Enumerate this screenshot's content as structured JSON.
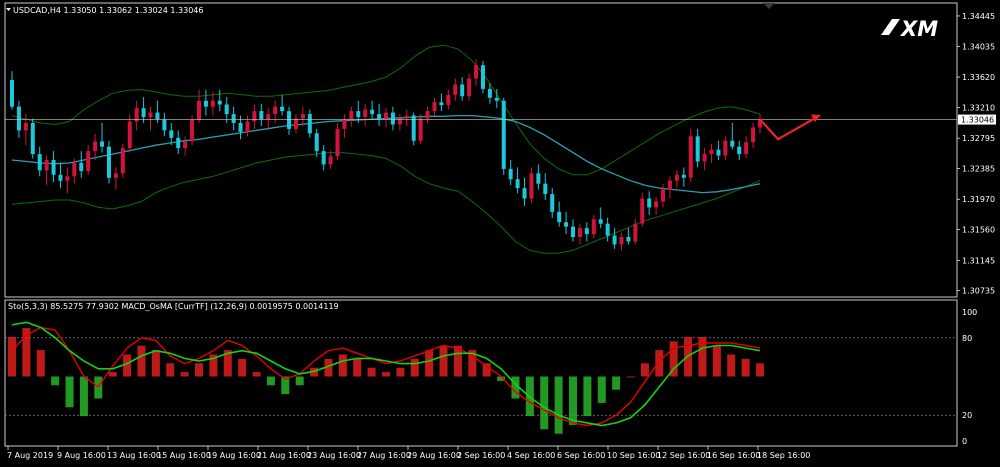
{
  "symbol_header": "USDCAD,H4  1.33050 1.33062 1.33024 1.33046",
  "indicator_header": "Sto(5,3,3) 85.5275 77.9302  MACD_OsMA [CurrTF] (12,26,9) 0.0019575 0.0014119",
  "brand": "XM",
  "current_price": "1.33046",
  "colors": {
    "background": "#000000",
    "bull_candle": "#d2143c",
    "bear_candle": "#1ec8dc",
    "ma": "#28a0b4",
    "bands": "#0a6e0a",
    "stoch_main": "#e60000",
    "stoch_signal": "#14d214",
    "osma_up": "#e11e1e",
    "osma_down": "#28b428",
    "arrow": "#e62828"
  },
  "chart_data": [
    {
      "type": "candlestick",
      "title": "USDCAD,H4",
      "price_ticks": [
        "1.34445",
        "1.34035",
        "1.33620",
        "1.33210",
        "1.32795",
        "1.32385",
        "1.31970",
        "1.31560",
        "1.31145",
        "1.30735"
      ],
      "ylim": [
        1.3065,
        1.3462
      ],
      "current_price": 1.33046,
      "forecast": {
        "type": "zigzag arrow",
        "direction": "down then up"
      },
      "candles": [
        [
          1.3358,
          1.337,
          1.3318,
          1.3322
        ],
        [
          1.3322,
          1.333,
          1.328,
          1.329
        ],
        [
          1.329,
          1.3312,
          1.327,
          1.33
        ],
        [
          1.33,
          1.3306,
          1.3252,
          1.3258
        ],
        [
          1.3258,
          1.3268,
          1.3228,
          1.3236
        ],
        [
          1.3236,
          1.3256,
          1.3216,
          1.325
        ],
        [
          1.325,
          1.3262,
          1.322,
          1.323
        ],
        [
          1.323,
          1.3246,
          1.3212,
          1.3222
        ],
        [
          1.3222,
          1.324,
          1.3205,
          1.3228
        ],
        [
          1.3228,
          1.3252,
          1.3218,
          1.3246
        ],
        [
          1.3246,
          1.3262,
          1.3226,
          1.3235
        ],
        [
          1.3235,
          1.327,
          1.323,
          1.3262
        ],
        [
          1.3262,
          1.3285,
          1.325,
          1.3275
        ],
        [
          1.3275,
          1.33,
          1.326,
          1.3268
        ],
        [
          1.3268,
          1.3276,
          1.3218,
          1.3226
        ],
        [
          1.3226,
          1.324,
          1.321,
          1.3232
        ],
        [
          1.3232,
          1.3272,
          1.3226,
          1.3266
        ],
        [
          1.3266,
          1.3312,
          1.326,
          1.3302
        ],
        [
          1.3302,
          1.333,
          1.329,
          1.332
        ],
        [
          1.332,
          1.3335,
          1.33,
          1.3308
        ],
        [
          1.3308,
          1.3322,
          1.329,
          1.3314
        ],
        [
          1.3314,
          1.333,
          1.33,
          1.3305
        ],
        [
          1.3305,
          1.3314,
          1.3282,
          1.329
        ],
        [
          1.329,
          1.33,
          1.327,
          1.328
        ],
        [
          1.328,
          1.329,
          1.3258,
          1.3266
        ],
        [
          1.3266,
          1.3282,
          1.3256,
          1.3275
        ],
        [
          1.3275,
          1.331,
          1.327,
          1.3304
        ],
        [
          1.3304,
          1.3345,
          1.33,
          1.333
        ],
        [
          1.333,
          1.3345,
          1.331,
          1.3322
        ],
        [
          1.3322,
          1.3342,
          1.331,
          1.333
        ],
        [
          1.333,
          1.3345,
          1.3316,
          1.3325
        ],
        [
          1.3325,
          1.3335,
          1.33,
          1.3312
        ],
        [
          1.3312,
          1.3322,
          1.329,
          1.33
        ],
        [
          1.33,
          1.331,
          1.3278,
          1.3288
        ],
        [
          1.3288,
          1.331,
          1.3282,
          1.3302
        ],
        [
          1.3302,
          1.3325,
          1.3292,
          1.3316
        ],
        [
          1.3316,
          1.3326,
          1.3296,
          1.3305
        ],
        [
          1.3305,
          1.332,
          1.329,
          1.3312
        ],
        [
          1.3312,
          1.333,
          1.33,
          1.3322
        ],
        [
          1.3322,
          1.3338,
          1.331,
          1.3316
        ],
        [
          1.3316,
          1.3322,
          1.3284,
          1.3292
        ],
        [
          1.3292,
          1.3312,
          1.3286,
          1.3306
        ],
        [
          1.3306,
          1.3322,
          1.3296,
          1.3312
        ],
        [
          1.3312,
          1.3318,
          1.328,
          1.3286
        ],
        [
          1.3286,
          1.3292,
          1.3254,
          1.3262
        ],
        [
          1.3262,
          1.327,
          1.3236,
          1.3244
        ],
        [
          1.3244,
          1.3262,
          1.3238,
          1.3255
        ],
        [
          1.3255,
          1.33,
          1.325,
          1.3292
        ],
        [
          1.3292,
          1.3312,
          1.328,
          1.3305
        ],
        [
          1.3305,
          1.3322,
          1.3295,
          1.3316
        ],
        [
          1.3316,
          1.333,
          1.33,
          1.3308
        ],
        [
          1.3308,
          1.3326,
          1.3296,
          1.3318
        ],
        [
          1.3318,
          1.333,
          1.3306,
          1.3312
        ],
        [
          1.3312,
          1.3326,
          1.3296,
          1.3306
        ],
        [
          1.3306,
          1.332,
          1.3294,
          1.3314
        ],
        [
          1.3314,
          1.3322,
          1.329,
          1.3298
        ],
        [
          1.3298,
          1.3312,
          1.329,
          1.3306
        ],
        [
          1.3306,
          1.3318,
          1.3296,
          1.331
        ],
        [
          1.331,
          1.3314,
          1.327,
          1.3276
        ],
        [
          1.3276,
          1.3312,
          1.3272,
          1.3306
        ],
        [
          1.3306,
          1.3322,
          1.33,
          1.3316
        ],
        [
          1.3316,
          1.3334,
          1.331,
          1.3328
        ],
        [
          1.3328,
          1.334,
          1.3316,
          1.3324
        ],
        [
          1.3324,
          1.3345,
          1.3318,
          1.3338
        ],
        [
          1.3338,
          1.336,
          1.333,
          1.3352
        ],
        [
          1.3352,
          1.3362,
          1.333,
          1.3336
        ],
        [
          1.3336,
          1.3366,
          1.333,
          1.336
        ],
        [
          1.336,
          1.3386,
          1.335,
          1.3378
        ],
        [
          1.3378,
          1.3384,
          1.334,
          1.3346
        ],
        [
          1.3346,
          1.3354,
          1.3326,
          1.3334
        ],
        [
          1.3334,
          1.3346,
          1.332,
          1.333
        ],
        [
          1.333,
          1.3334,
          1.323,
          1.3238
        ],
        [
          1.3238,
          1.325,
          1.3216,
          1.3224
        ],
        [
          1.3224,
          1.324,
          1.3205,
          1.3212
        ],
        [
          1.3212,
          1.3226,
          1.3188,
          1.3198
        ],
        [
          1.3198,
          1.324,
          1.3192,
          1.3232
        ],
        [
          1.3232,
          1.3244,
          1.321,
          1.3218
        ],
        [
          1.3218,
          1.3232,
          1.3196,
          1.3204
        ],
        [
          1.3204,
          1.3212,
          1.3172,
          1.318
        ],
        [
          1.318,
          1.3194,
          1.316,
          1.3166
        ],
        [
          1.3166,
          1.318,
          1.315,
          1.316
        ],
        [
          1.316,
          1.317,
          1.314,
          1.3146
        ],
        [
          1.3146,
          1.3164,
          1.3136,
          1.3158
        ],
        [
          1.3158,
          1.3166,
          1.314,
          1.315
        ],
        [
          1.315,
          1.3176,
          1.3144,
          1.317
        ],
        [
          1.317,
          1.3186,
          1.3158,
          1.3164
        ],
        [
          1.3164,
          1.3172,
          1.314,
          1.3148
        ],
        [
          1.3148,
          1.3158,
          1.313,
          1.3136
        ],
        [
          1.3136,
          1.3152,
          1.3128,
          1.3146
        ],
        [
          1.3146,
          1.3158,
          1.3136,
          1.314
        ],
        [
          1.314,
          1.317,
          1.3136,
          1.3164
        ],
        [
          1.3164,
          1.3206,
          1.316,
          1.3198
        ],
        [
          1.3198,
          1.3208,
          1.3176,
          1.3186
        ],
        [
          1.3186,
          1.32,
          1.3176,
          1.3194
        ],
        [
          1.3194,
          1.3218,
          1.3186,
          1.321
        ],
        [
          1.321,
          1.3228,
          1.3198,
          1.3222
        ],
        [
          1.3222,
          1.3236,
          1.3212,
          1.323
        ],
        [
          1.323,
          1.324,
          1.3214,
          1.3226
        ],
        [
          1.3226,
          1.3292,
          1.322,
          1.3282
        ],
        [
          1.3282,
          1.3292,
          1.324,
          1.3248
        ],
        [
          1.3248,
          1.3266,
          1.3236,
          1.3258
        ],
        [
          1.3258,
          1.3272,
          1.3246,
          1.3264
        ],
        [
          1.3264,
          1.3276,
          1.325,
          1.3256
        ],
        [
          1.3256,
          1.3282,
          1.325,
          1.3276
        ],
        [
          1.3276,
          1.33,
          1.3264,
          1.3268
        ],
        [
          1.3268,
          1.3276,
          1.325,
          1.3258
        ],
        [
          1.3258,
          1.3282,
          1.3252,
          1.3274
        ],
        [
          1.3274,
          1.33,
          1.3266,
          1.3294
        ],
        [
          1.3294,
          1.3312,
          1.3286,
          1.3305
        ]
      ],
      "ma": [
        1.325,
        1.3248,
        1.3246,
        1.3245,
        1.3246,
        1.325,
        1.3254,
        1.3258,
        1.3262,
        1.3266,
        1.327,
        1.3273,
        1.3276,
        1.3278,
        1.3281,
        1.3284,
        1.3287,
        1.329,
        1.3293,
        1.3296,
        1.3298,
        1.33,
        1.3302,
        1.3303,
        1.3304,
        1.3305,
        1.3306,
        1.3307,
        1.3308,
        1.3309,
        1.3309,
        1.331,
        1.331,
        1.3308,
        1.3306,
        1.3302,
        1.3294,
        1.3284,
        1.3272,
        1.326,
        1.3248,
        1.3238,
        1.323,
        1.3222,
        1.3216,
        1.3212,
        1.321,
        1.3208,
        1.3206,
        1.3207,
        1.321,
        1.3214,
        1.3218
      ],
      "upper_band": [
        1.331,
        1.3305,
        1.33,
        1.3298,
        1.3302,
        1.3318,
        1.333,
        1.334,
        1.3344,
        1.3345,
        1.3342,
        1.3338,
        1.3336,
        1.3336,
        1.3338,
        1.334,
        1.3338,
        1.3336,
        1.3336,
        1.3338,
        1.334,
        1.3342,
        1.3344,
        1.3348,
        1.3352,
        1.3356,
        1.3362,
        1.3374,
        1.339,
        1.3402,
        1.3405,
        1.34,
        1.3384,
        1.336,
        1.333,
        1.33,
        1.3272,
        1.3252,
        1.3238,
        1.323,
        1.323,
        1.3238,
        1.325,
        1.3262,
        1.3274,
        1.3286,
        1.3296,
        1.3306,
        1.3314,
        1.332,
        1.3322,
        1.3318,
        1.3312
      ],
      "lower_band": [
        1.319,
        1.3192,
        1.3194,
        1.3196,
        1.3196,
        1.3192,
        1.3186,
        1.3184,
        1.3188,
        1.3194,
        1.3206,
        1.3214,
        1.322,
        1.3224,
        1.3228,
        1.3234,
        1.324,
        1.3246,
        1.325,
        1.3254,
        1.3256,
        1.3258,
        1.326,
        1.326,
        1.3258,
        1.3256,
        1.3252,
        1.3242,
        1.3228,
        1.3218,
        1.3212,
        1.3208,
        1.3194,
        1.3178,
        1.316,
        1.314,
        1.3128,
        1.3124,
        1.3124,
        1.3128,
        1.3136,
        1.3144,
        1.3152,
        1.316,
        1.3168,
        1.3174,
        1.318,
        1.3186,
        1.3192,
        1.3198,
        1.3206,
        1.3214,
        1.3222
      ]
    },
    {
      "type": "oscillator",
      "title": "Sto(5,3,3)  MACD_OsMA [CurrTF] (12,26,9)",
      "level_ticks": [
        "100",
        "80",
        "20",
        "0"
      ],
      "ylim": [
        0,
        100
      ],
      "x_ticks": [
        "7 Aug 2019",
        "9 Aug 16:00",
        "13 Aug 16:00",
        "15 Aug 16:00",
        "19 Aug 16:00",
        "21 Aug 16:00",
        "23 Aug 16:00",
        "27 Aug 16:00",
        "29 Aug 16:00",
        "2 Sep 16:00",
        "4 Sep 16:00",
        "6 Sep 16:00",
        "10 Sep 16:00",
        "12 Sep 16:00",
        "16 Sep 16:00",
        "18 Sep 16:00"
      ],
      "stoch_main": [
        70,
        82,
        88,
        86,
        70,
        50,
        42,
        58,
        72,
        80,
        78,
        66,
        60,
        64,
        70,
        78,
        74,
        66,
        56,
        48,
        52,
        62,
        70,
        72,
        68,
        64,
        60,
        62,
        66,
        70,
        74,
        72,
        66,
        58,
        50,
        38,
        30,
        24,
        18,
        14,
        12,
        14,
        20,
        30,
        46,
        62,
        72,
        74,
        76,
        76,
        76,
        74,
        72
      ],
      "stoch_signal": [
        90,
        92,
        88,
        80,
        70,
        62,
        56,
        56,
        60,
        66,
        70,
        68,
        64,
        62,
        64,
        68,
        70,
        68,
        62,
        56,
        52,
        54,
        58,
        62,
        64,
        64,
        62,
        60,
        60,
        62,
        66,
        68,
        68,
        64,
        56,
        44,
        34,
        26,
        20,
        16,
        14,
        12,
        14,
        18,
        28,
        42,
        56,
        66,
        72,
        74,
        74,
        72,
        70
      ],
      "osma": [
        18,
        22,
        12,
        -4,
        -14,
        -18,
        -10,
        2,
        10,
        14,
        12,
        6,
        2,
        6,
        10,
        12,
        8,
        2,
        -4,
        -8,
        -4,
        4,
        8,
        10,
        8,
        4,
        2,
        4,
        8,
        12,
        14,
        14,
        12,
        6,
        -2,
        -10,
        -18,
        -24,
        -26,
        -22,
        -18,
        -12,
        -6,
        0,
        6,
        12,
        16,
        18,
        18,
        14,
        10,
        8,
        6
      ]
    }
  ]
}
